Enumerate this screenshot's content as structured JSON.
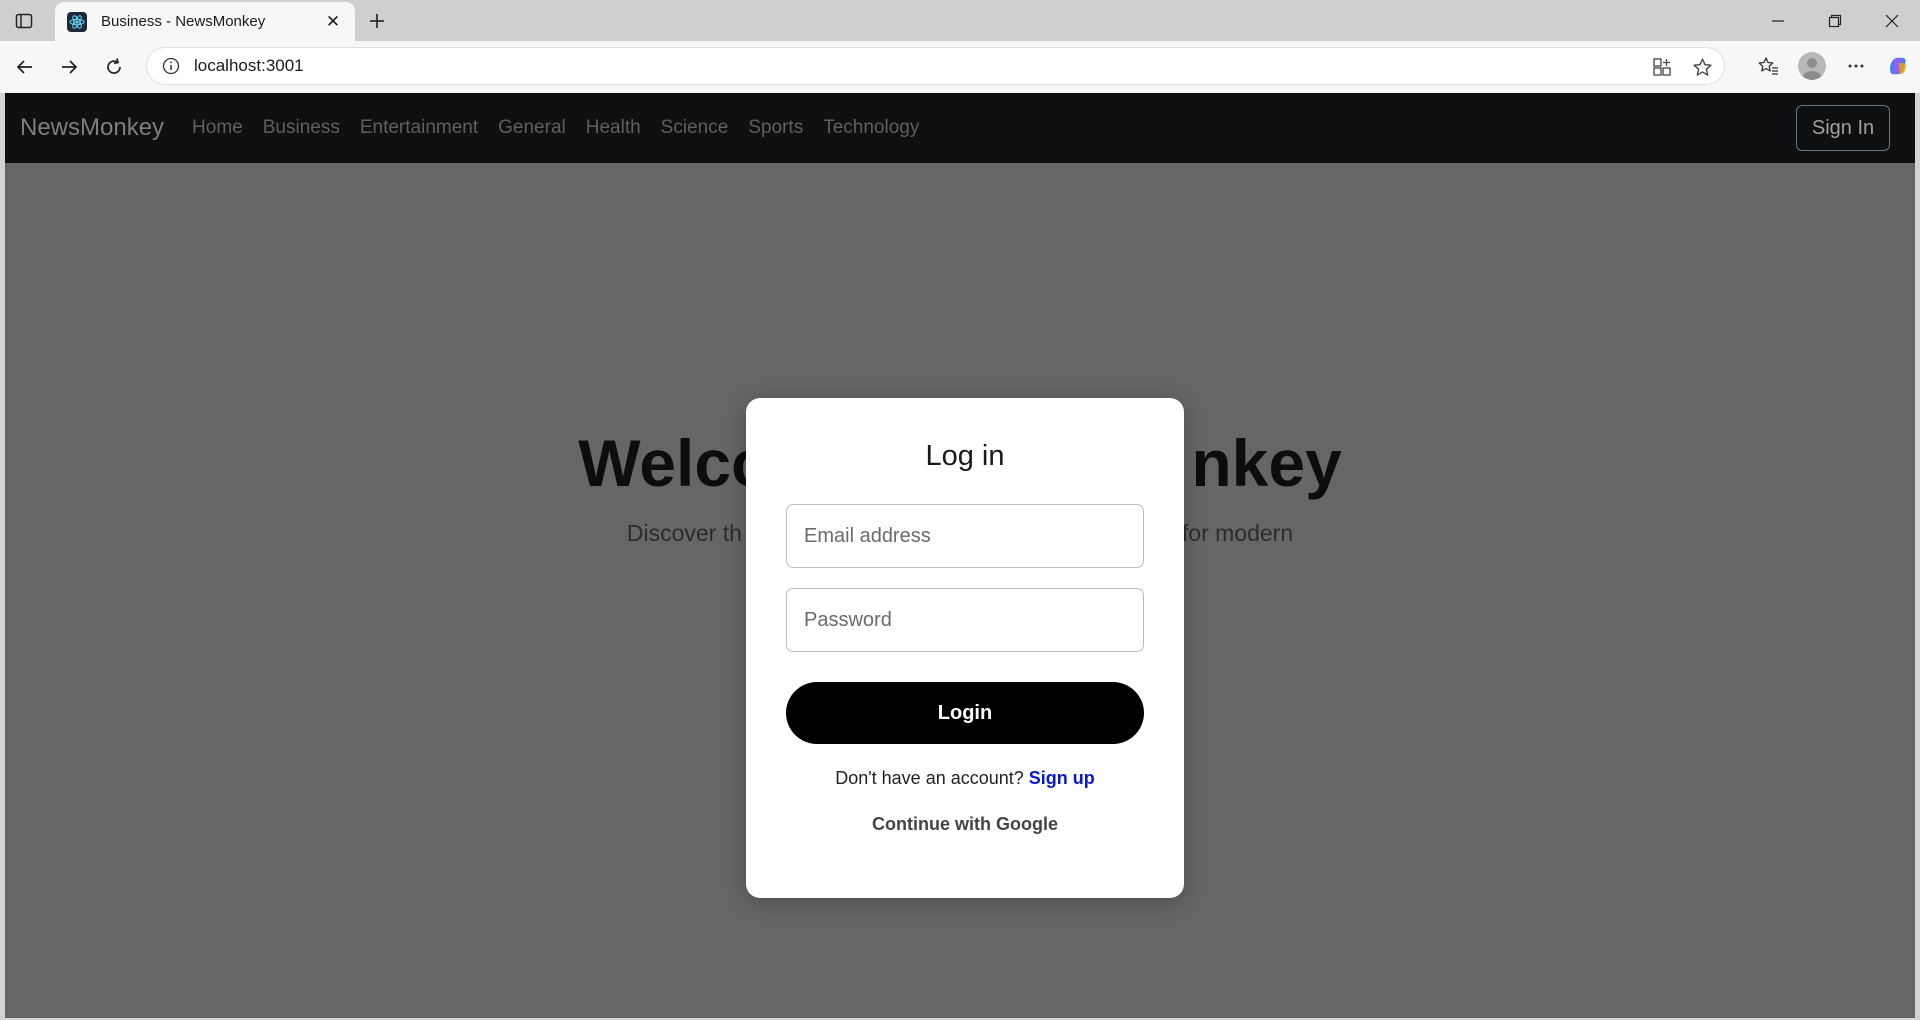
{
  "browser": {
    "tab_title": "Business - NewsMonkey",
    "url": "localhost:3001"
  },
  "navbar": {
    "brand": "NewsMonkey",
    "links": [
      "Home",
      "Business",
      "Entertainment",
      "General",
      "Health",
      "Science",
      "Sports",
      "Technology"
    ],
    "signin_label": "Sign In"
  },
  "hero": {
    "title_left": "Welco",
    "title_right": "nkey",
    "subtitle_left": "Discover th",
    "subtitle_right": "for modern"
  },
  "modal": {
    "title": "Log in",
    "email_placeholder": "Email address",
    "password_placeholder": "Password",
    "login_label": "Login",
    "signup_prompt": "Don't have an account?",
    "signup_link": "Sign up",
    "google_label": "Continue with Google"
  },
  "colors": {
    "navbar_bg": "#0f1012",
    "overlay_bg": "#666666",
    "login_button": "#000000",
    "signup_link": "#0a18d6"
  }
}
